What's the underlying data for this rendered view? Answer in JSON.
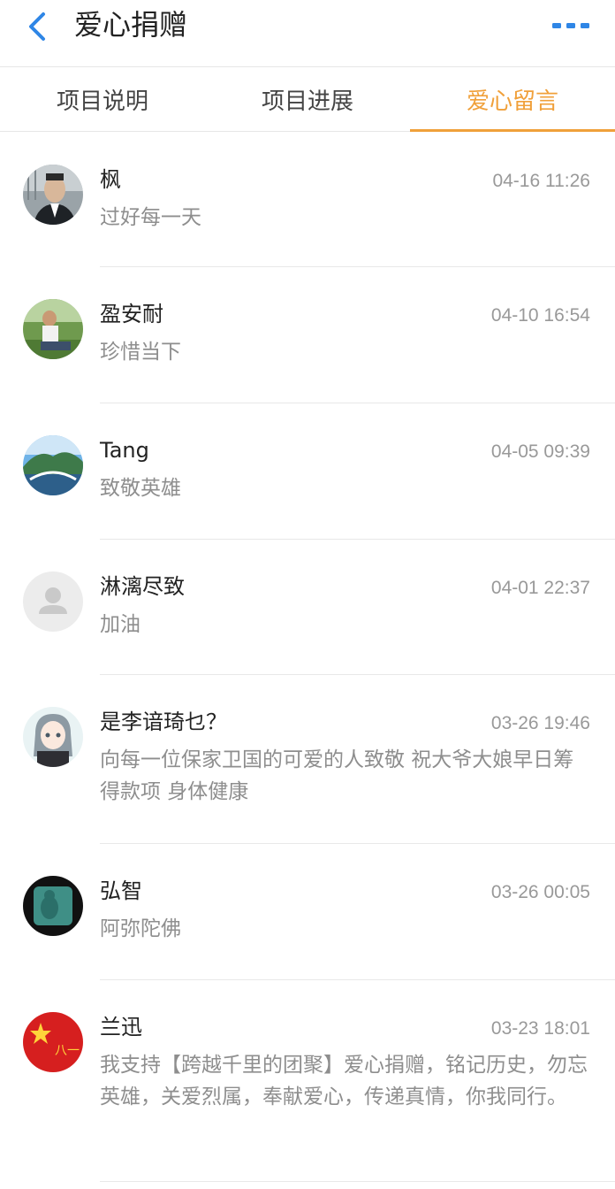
{
  "header": {
    "title": "爱心捐赠",
    "back_icon": "chevron-left-icon",
    "more_icon": "more-dots-icon",
    "accent": "#2f86e6"
  },
  "tabs": [
    {
      "label": "项目说明",
      "active": false
    },
    {
      "label": "项目进展",
      "active": false
    },
    {
      "label": "爱心留言",
      "active": true
    }
  ],
  "active_color": "#f0a03a",
  "comments": [
    {
      "name": "枫",
      "time": "04-16 11:26",
      "message": "过好每一天"
    },
    {
      "name": "盈安耐",
      "time": "04-10 16:54",
      "message": "珍惜当下"
    },
    {
      "name": "Tang",
      "time": "04-05 09:39",
      "message": "致敬英雄"
    },
    {
      "name": "淋漓尽致",
      "time": "04-01 22:37",
      "message": "加油"
    },
    {
      "name": "是李谙琦乜？",
      "time": "03-26 19:46",
      "message": "向每一位保家卫国的可爱的人致敬 祝大爷大娘早日筹得款项 身体健康"
    },
    {
      "name": "弘智",
      "time": "03-26 00:05",
      "message": "阿弥陀佛"
    },
    {
      "name": "兰迅",
      "time": "03-23 18:01",
      "message": "我支持【跨越千里的团聚】爱心捐赠，铭记历史，勿忘英雄，关爱烈属，奉献爱心，传递真情，你我同行。"
    }
  ]
}
